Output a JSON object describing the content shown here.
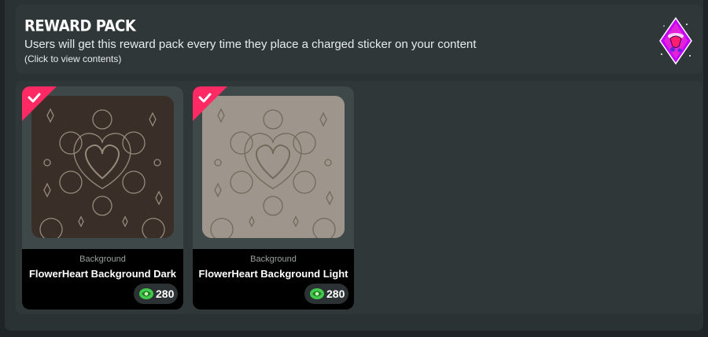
{
  "header": {
    "title": "REWARD PACK",
    "subtitle": "Users will get this reward pack every time they place a charged sticker on your content",
    "click_hint": "(Click to view contents)",
    "badge_icon": "reward-pack-icon"
  },
  "items": [
    {
      "category": "Background",
      "name": "FlowerHeart Background Dark",
      "price": "280",
      "price_icon": "points-icon",
      "selected": true,
      "colors": {
        "bg": "#3a2f28",
        "pattern": "#a79a8c"
      }
    },
    {
      "category": "Background",
      "name": "FlowerHeart Background Light",
      "price": "280",
      "price_icon": "points-icon",
      "selected": true,
      "colors": {
        "bg": "#9e968c",
        "pattern": "#6f6456"
      }
    }
  ],
  "colors": {
    "accent_ribbon": "#ff2a64",
    "price_green": "#41c94b"
  }
}
